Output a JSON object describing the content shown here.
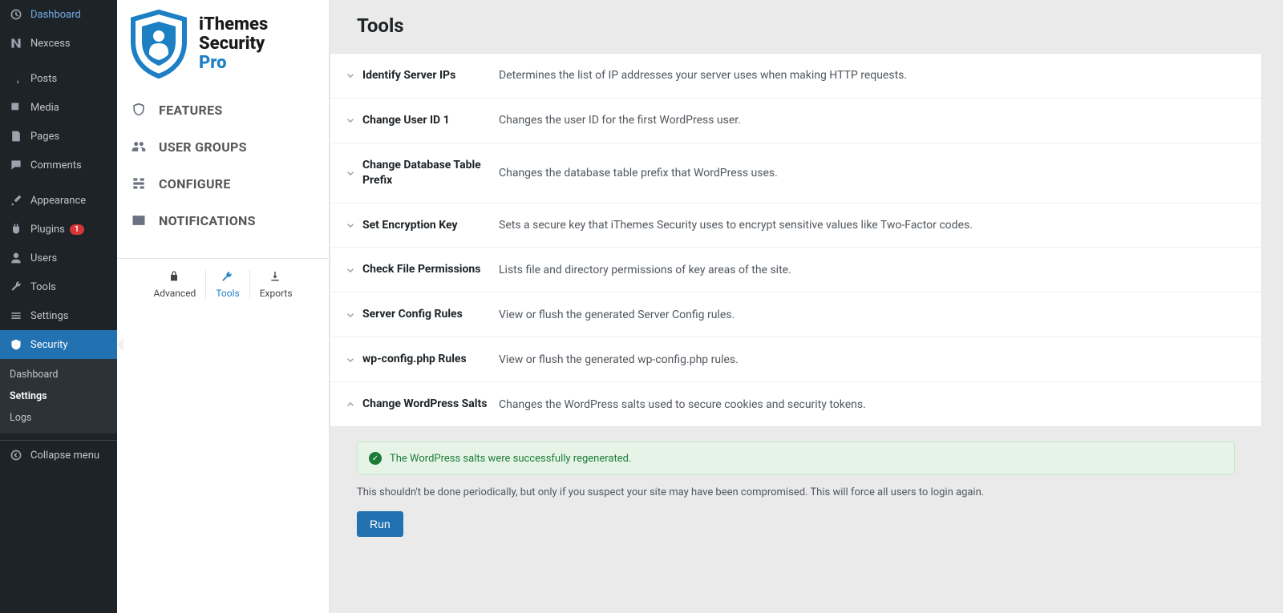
{
  "wp_menu": {
    "dashboard": "Dashboard",
    "nexcess": "Nexcess",
    "posts": "Posts",
    "media": "Media",
    "pages": "Pages",
    "comments": "Comments",
    "appearance": "Appearance",
    "plugins": "Plugins",
    "plugins_badge": "1",
    "users": "Users",
    "tools": "Tools",
    "settings": "Settings",
    "security": "Security",
    "collapse": "Collapse menu"
  },
  "wp_submenu": {
    "dashboard": "Dashboard",
    "settings": "Settings",
    "logs": "Logs"
  },
  "brand": {
    "line1": "iThemes",
    "line2": "Security",
    "line3": "Pro"
  },
  "ithemes_nav": {
    "features": "FEATURES",
    "user_groups": "USER GROUPS",
    "configure": "CONFIGURE",
    "notifications": "NOTIFICATIONS"
  },
  "ithemes_tabs": {
    "advanced": "Advanced",
    "tools": "Tools",
    "exports": "Exports"
  },
  "page": {
    "title": "Tools"
  },
  "tools": [
    {
      "name": "Identify Server IPs",
      "desc": "Determines the list of IP addresses your server uses when making HTTP requests.",
      "expanded": false
    },
    {
      "name": "Change User ID 1",
      "desc": "Changes the user ID for the first WordPress user.",
      "expanded": false
    },
    {
      "name": "Change Database Table Prefix",
      "desc": "Changes the database table prefix that WordPress uses.",
      "expanded": false
    },
    {
      "name": "Set Encryption Key",
      "desc": "Sets a secure key that iThemes Security uses to encrypt sensitive values like Two-Factor codes.",
      "expanded": false
    },
    {
      "name": "Check File Permissions",
      "desc": "Lists file and directory permissions of key areas of the site.",
      "expanded": false
    },
    {
      "name": "Server Config Rules",
      "desc": "View or flush the generated Server Config rules.",
      "expanded": false
    },
    {
      "name": "wp-config.php Rules",
      "desc": "View or flush the generated wp-config.php rules.",
      "expanded": false
    },
    {
      "name": "Change WordPress Salts",
      "desc": "Changes the WordPress salts used to secure cookies and security tokens.",
      "expanded": true
    }
  ],
  "success_message": "The WordPress salts were successfully regenerated.",
  "note": "This shouldn't be done periodically, but only if you suspect your site may have been compromised. This will force all users to login again.",
  "run_label": "Run"
}
